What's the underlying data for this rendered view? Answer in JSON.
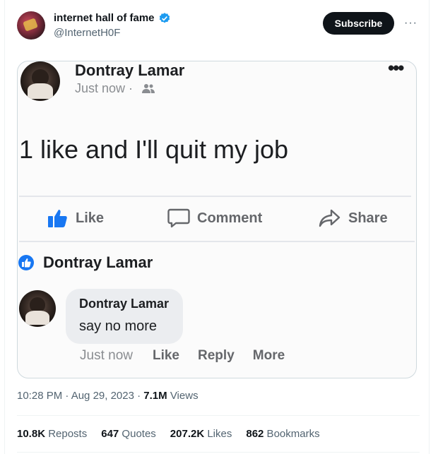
{
  "tweet": {
    "display_name": "internet hall of fame",
    "handle": "@InternetH0F",
    "subscribe_label": "Subscribe",
    "more_icon": "more-horizontal-icon",
    "verified_color": "#1d9bf0"
  },
  "media_post": {
    "author": "Dontray Lamar",
    "time": "Just now · ",
    "privacy_icon": "friends-icon",
    "text": "1 like and I'll quit my job",
    "actions": {
      "like": "Like",
      "comment": "Comment",
      "share": "Share"
    },
    "reactor_name": "Dontray Lamar",
    "comment": {
      "author": "Dontray Lamar",
      "text": "say no more",
      "time": "Just now",
      "like": "Like",
      "reply": "Reply",
      "more": "More"
    },
    "like_color": "#1877f2"
  },
  "footer": {
    "time_date": "10:28 PM · Aug 29, 2023 · ",
    "views_count": "7.1M",
    "views_label": " Views",
    "reposts_count": "10.8K",
    "reposts_label": " Reposts",
    "quotes_count": "647",
    "quotes_label": " Quotes",
    "likes_count": "207.2K",
    "likes_label": " Likes",
    "bookmarks_count": "862",
    "bookmarks_label": " Bookmarks"
  }
}
